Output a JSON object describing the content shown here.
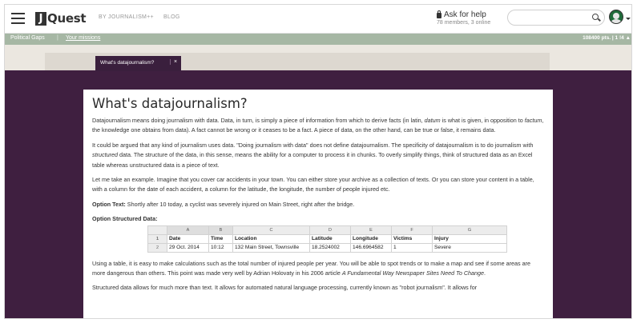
{
  "header": {
    "logo_letter": "J",
    "logo_text": "Quest",
    "tagline": "BY JOURNALISM++",
    "blog_link": "BLOG",
    "ask_title": "Ask for help",
    "ask_subtitle": "78 members, 3 online",
    "search_placeholder": ""
  },
  "subbar": {
    "breadcrumb": "Political Gaps",
    "missions_link": "Your missions",
    "points": "108400 pts. | 1 !4 ▲"
  },
  "popup_tab": {
    "label": "What's datajournalism?",
    "close": "×"
  },
  "article": {
    "title": "What's datajournalism?",
    "p1_a": "Datajournalism means doing journalism with data. Data, in turn, is simply a piece of information from which to derive facts (in latin, ",
    "p1_em1": "datum",
    "p1_b": " is what is given, in opposition to ",
    "p1_em2": "factum",
    "p1_c": ", the knowledge one obtains from data). A fact cannot be wrong or it ceases to be a fact. A piece of data, on the other hand, can be true or false, it remains data.",
    "p2_a": "It could be argued that any kind of journalism uses data. \"Doing journalism with data\" does not define datajournalism. The specificity of datajournalism is to do journalism with ",
    "p2_em": "structured",
    "p2_b": " data. The structure of the data, in this sense, means the ability for a computer to process it in chunks. To overly simplify things, think of structured data as an Excel table whereas unstructured data is a piece of text.",
    "p3": "Let me take an example. Imagine that you cover car accidents in your town. You can either store your archive as a collection of texts. Or you can store your content in a table, with a column for the date of each accident, a column for the latitude, the longitude, the number of people injured etc.",
    "option_text_label": "Option Text:",
    "option_text_value": " Shortly after 10 today, a cyclist was severely injured on Main Street, right after the bridge.",
    "option_structured_label": "Option Structured Data:",
    "p4_a": "Using a table, it is easy to make calculations such as the total number of injured people per year. You will be able to spot trends or to make a map and see if some areas are more dangerous than others. This point was made very well by Adrian Holovaty in his 2006 article ",
    "p4_em": "A Fundamental Way Newspaper Sites Need To Change",
    "p4_b": ".",
    "p5": "Structured data allows for much more than text. It allows for automated natural language processing, currently known as \"robot journalism\". It allows for"
  },
  "sheet": {
    "columns": [
      "A",
      "B",
      "C",
      "D",
      "E",
      "F",
      "G"
    ],
    "rows": [
      {
        "num": "1",
        "cells": [
          "Date",
          "Time",
          "Location",
          "Latitude",
          "Longitude",
          "Victims",
          "Injury"
        ]
      },
      {
        "num": "2",
        "cells": [
          "29 Oct. 2014",
          "10:12",
          "132 Main Street, Townsville",
          "18.2524002",
          "146.6964582",
          "1",
          "Severe"
        ]
      }
    ]
  },
  "colors": {
    "overlay": "#3f1f40",
    "subbar": "#a6b7a4",
    "tab_popup": "#3a1f3d"
  }
}
